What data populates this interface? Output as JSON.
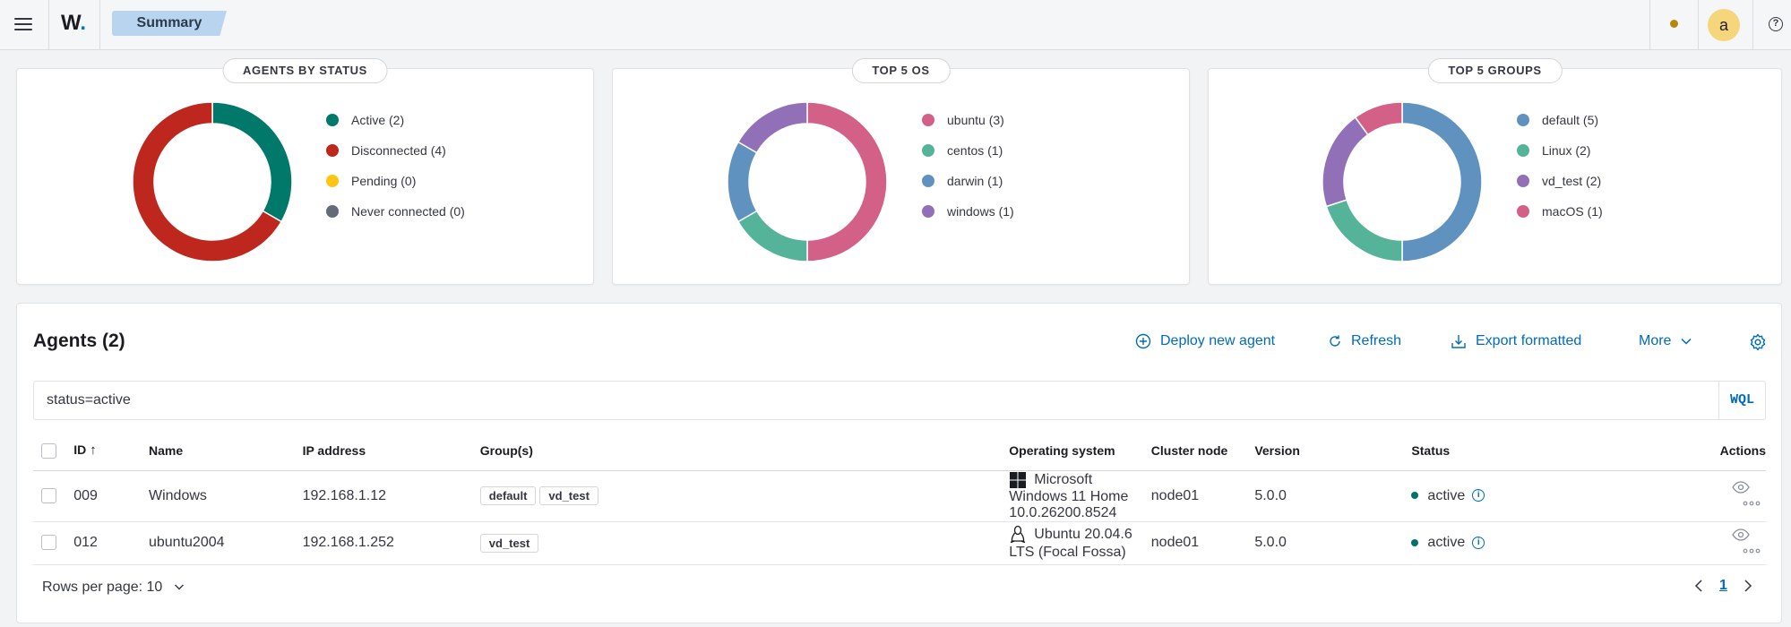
{
  "header": {
    "logo_text": "W",
    "logo_dot": ".",
    "breadcrumb": "Summary",
    "avatar_letter": "a",
    "help_glyph": "?"
  },
  "cards": [
    {
      "title": "AGENTS BY STATUS",
      "legend": [
        {
          "label": "Active (2)",
          "color": "#00796b",
          "value": 2
        },
        {
          "label": "Disconnected (4)",
          "color": "#bd271e",
          "value": 4
        },
        {
          "label": "Pending (0)",
          "color": "#fec514",
          "value": 0
        },
        {
          "label": "Never connected (0)",
          "color": "#646a77",
          "value": 0
        }
      ]
    },
    {
      "title": "TOP 5 OS",
      "legend": [
        {
          "label": "ubuntu (3)",
          "color": "#d36086",
          "value": 3
        },
        {
          "label": "centos (1)",
          "color": "#54b399",
          "value": 1
        },
        {
          "label": "darwin (1)",
          "color": "#6092c0",
          "value": 1
        },
        {
          "label": "windows (1)",
          "color": "#9170b8",
          "value": 1
        }
      ]
    },
    {
      "title": "TOP 5 GROUPS",
      "legend": [
        {
          "label": "default (5)",
          "color": "#6092c0",
          "value": 5
        },
        {
          "label": "Linux (2)",
          "color": "#54b399",
          "value": 2
        },
        {
          "label": "vd_test (2)",
          "color": "#9170b8",
          "value": 2
        },
        {
          "label": "macOS (1)",
          "color": "#d36086",
          "value": 1
        }
      ]
    }
  ],
  "agents": {
    "title": "Agents (2)",
    "actions": {
      "deploy": "Deploy new agent",
      "refresh": "Refresh",
      "export": "Export formatted",
      "more": "More"
    },
    "search_value": "status=active",
    "wql_label": "WQL",
    "columns": {
      "id": "ID",
      "name": "Name",
      "ip": "IP address",
      "groups": "Group(s)",
      "os": "Operating system",
      "node": "Cluster node",
      "version": "Version",
      "status": "Status",
      "actions": "Actions"
    },
    "sort_arrow": "↑",
    "rows": [
      {
        "id": "009",
        "name": "Windows",
        "ip": "192.168.1.12",
        "groups": [
          "default",
          "vd_test"
        ],
        "os": "Microsoft Windows 11 Home 10.0.26200.8524",
        "os_icon": "windows-icon",
        "node": "node01",
        "version": "5.0.0",
        "status": "active"
      },
      {
        "id": "012",
        "name": "ubuntu2004",
        "ip": "192.168.1.252",
        "groups": [
          "vd_test"
        ],
        "os": "Ubuntu 20.04.6 LTS (Focal Fossa)",
        "os_icon": "linux-icon",
        "node": "node01",
        "version": "5.0.0",
        "status": "active"
      }
    ],
    "rows_per_page": "Rows per page: 10",
    "page": "1"
  },
  "colors": {
    "accent": "#006bb8",
    "active": "#00726b"
  }
}
